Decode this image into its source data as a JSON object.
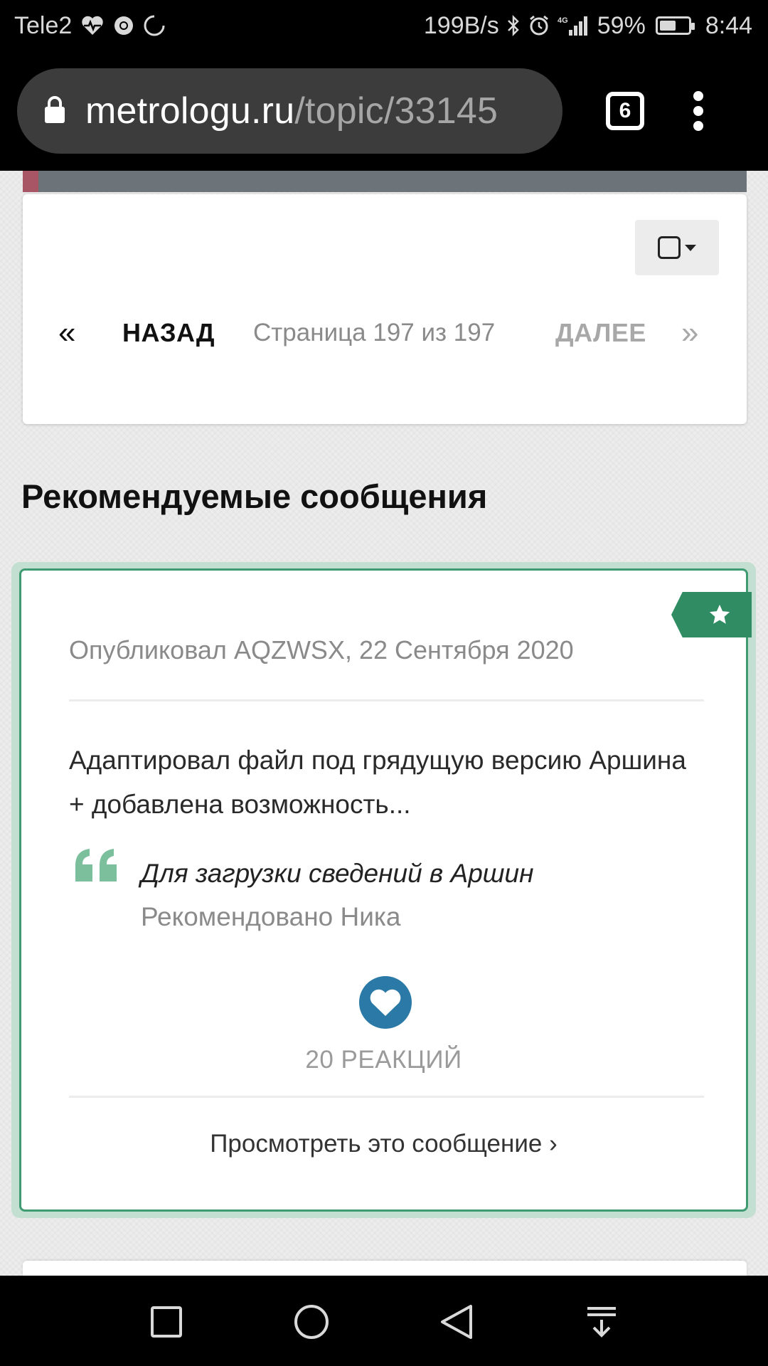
{
  "status_bar": {
    "carrier": "Tele2",
    "net_speed": "199B/s",
    "signal_type": "4G",
    "battery_percent": "59%",
    "battery_level": 0.59,
    "time": "8:44"
  },
  "browser": {
    "url_host": "metrologu.ru",
    "url_path": "/topic/33145",
    "tab_count": "6"
  },
  "pagination": {
    "first_symbol": "«",
    "prev_label": "НАЗАД",
    "page_info": "Страница 197 из 197",
    "next_label": "ДАЛЕЕ",
    "last_symbol": "»"
  },
  "recommended": {
    "section_title": "Рекомендуемые сообщения",
    "post": {
      "meta": "Опубликовал AQZWSX, 22 Сентября 2020",
      "excerpt": "Адаптировал файл под грядущую версию Аршина + добавлена возможность...",
      "title": "Для загрузки сведений в Аршин",
      "recommended_by": "Рекомендовано Ника",
      "reactions": "20 РЕАКЦИЙ",
      "view_link": "Просмотреть это сообщение ›"
    }
  },
  "colors": {
    "accent_green": "#2f8c63",
    "reaction_blue": "#2a79a6",
    "strip_gray": "#6c7379",
    "strip_accent": "#a85565"
  },
  "icons": {
    "status_left": [
      "heart-pulse-icon",
      "chrome-icon",
      "sync-icon"
    ],
    "status_right": [
      "bluetooth-icon",
      "alarm-icon",
      "signal-icon",
      "battery-icon"
    ],
    "browser": [
      "lock-icon",
      "tabs-icon",
      "menu-icon"
    ],
    "post": [
      "star-icon",
      "quote-icon",
      "heart-icon"
    ],
    "nav": [
      "recents-icon",
      "home-icon",
      "back-icon",
      "notification-pulldown-icon"
    ]
  }
}
